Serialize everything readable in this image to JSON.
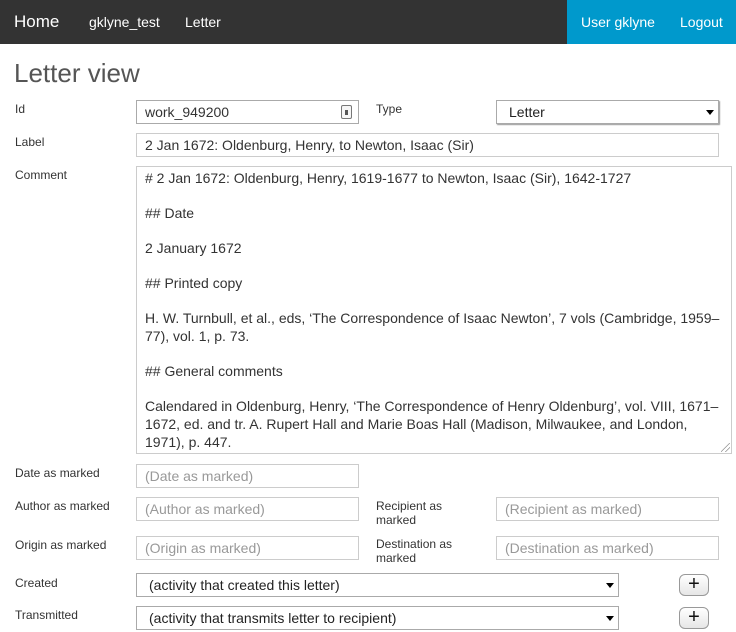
{
  "nav": {
    "home": "Home",
    "collection": "gklyne_test",
    "letter": "Letter",
    "user": "User gklyne",
    "logout": "Logout"
  },
  "page": {
    "title": "Letter view"
  },
  "form": {
    "id": {
      "label": "Id",
      "value": "work_949200"
    },
    "type": {
      "label": "Type",
      "value": "Letter"
    },
    "label": {
      "label": "Label",
      "value": "2 Jan 1672: Oldenburg, Henry, to Newton, Isaac (Sir)"
    },
    "comment": {
      "label": "Comment",
      "paragraphs": [
        "# 2 Jan 1672: Oldenburg, Henry, 1619-1677 to Newton, Isaac (Sir), 1642-1727",
        "## Date",
        "2 January 1672",
        "## Printed copy",
        "H. W. Turnbull, et al., eds, ‘The Correspondence of Isaac Newton’, 7 vols (Cambridge, 1959–77), vol. 1, p. 73.",
        "## General comments",
        "Calendared in Oldenburg, Henry,  ‘The Correspondence of Henry Oldenburg’, vol. VIII, 1671–1672, ed. and tr. A. Rupert Hall and Marie Boas Hall (Madison, Milwaukee, and London, 1971), p. 447."
      ]
    },
    "date_as_marked": {
      "label": "Date as marked",
      "placeholder": "(Date as marked)"
    },
    "author_as_marked": {
      "label": "Author as marked",
      "placeholder": "(Author as marked)"
    },
    "recipient_as_marked": {
      "label_line1": "Recipient as",
      "label_line2": "marked",
      "placeholder": "(Recipient as marked)"
    },
    "origin_as_marked": {
      "label": "Origin as marked",
      "placeholder": "(Origin as marked)"
    },
    "destination_as_marked": {
      "label_line1": "Destination as",
      "label_line2": "marked",
      "placeholder": "(Destination as marked)"
    },
    "created": {
      "label": "Created",
      "value": "(activity that created this letter)",
      "add": "+"
    },
    "transmitted": {
      "label": "Transmitted",
      "value": "(activity that transmits letter to recipient)",
      "add": "+"
    }
  }
}
